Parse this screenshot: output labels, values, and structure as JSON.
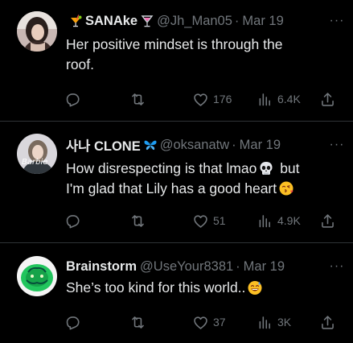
{
  "colors": {
    "background": "#000000",
    "text_primary": "#e7e9ea",
    "text_secondary": "#71767b",
    "divider": "#2f3336",
    "butterfly": "#1d9bf0"
  },
  "tweets": [
    {
      "display_name": "SANAke",
      "name_emoji_before": "tropical-drink-emoji",
      "name_emoji_after": "cocktail-glass-emoji",
      "handle": "@Jh_Man05",
      "separator": "·",
      "date": "Mar 19",
      "more": "···",
      "text_line1": "Her positive mindset is through the",
      "text_line2": "roof.",
      "actions": {
        "reply": "",
        "retweet": "",
        "like": "176",
        "views": "6.4K",
        "share": ""
      }
    },
    {
      "display_name": "사나 CLONE",
      "name_emoji_after": "blue-butterfly-emoji",
      "handle": "@oksanatw",
      "separator": "·",
      "date": "Mar 19",
      "more": "···",
      "text_part1": "How disrespecting is that lmao",
      "emoji1": "skull-emoji",
      "text_part2": " but",
      "text_line2": "I'm glad that Lily has a good heart",
      "emoji2": "face-blowing-kiss-emoji",
      "actions": {
        "reply": "",
        "retweet": "",
        "like": "51",
        "views": "4.9K",
        "share": ""
      }
    },
    {
      "display_name": "Brainstorm",
      "handle": "@UseYour8381",
      "separator": "·",
      "date": "Mar 19",
      "more": "···",
      "text_line1": "She’s too kind for this world..",
      "emoji1": "grinning-sweat-emoji",
      "actions": {
        "reply": "",
        "retweet": "",
        "like": "37",
        "views": "3K",
        "share": ""
      }
    }
  ]
}
